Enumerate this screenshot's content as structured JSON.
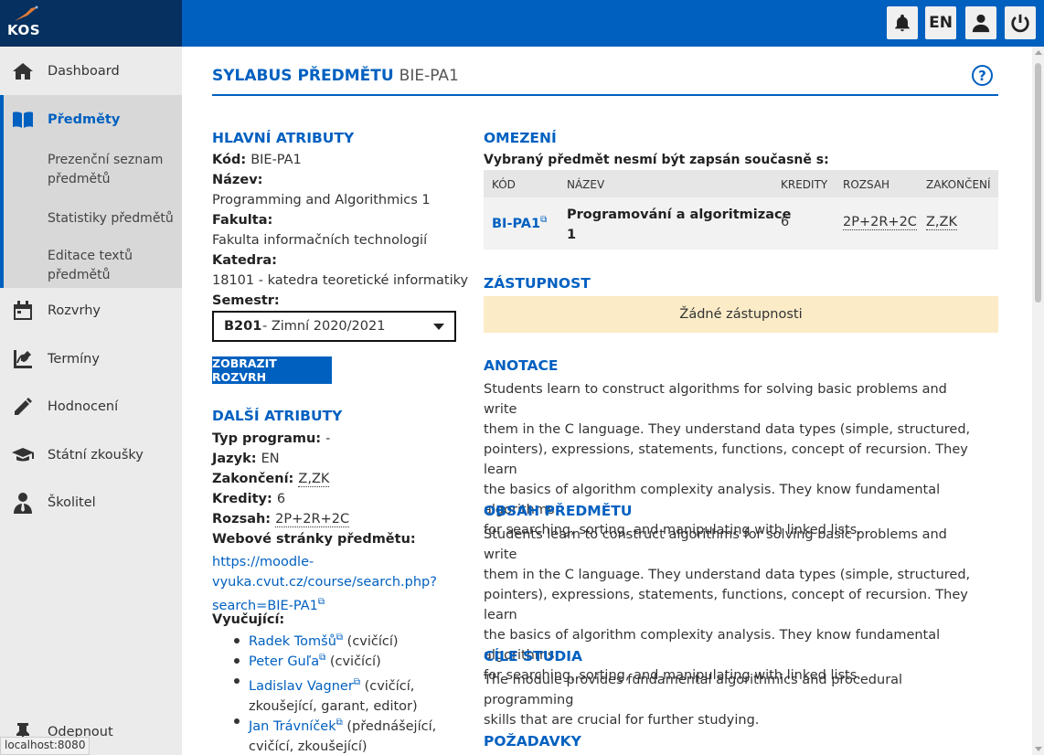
{
  "app": {
    "logo": "KOS",
    "status_url": "localhost:8080"
  },
  "topbar": {
    "lang": "EN"
  },
  "sidebar": {
    "items": [
      {
        "label": "Dashboard",
        "icon": "home-icon"
      },
      {
        "label": "Předměty",
        "icon": "book-icon"
      },
      {
        "label": "Rozvrhy",
        "icon": "calendar-icon"
      },
      {
        "label": "Termíny",
        "icon": "signature-icon"
      },
      {
        "label": "Hodnocení",
        "icon": "pencil-icon"
      },
      {
        "label": "Státní zkoušky",
        "icon": "graduation-cap-icon"
      },
      {
        "label": "Školitel",
        "icon": "person-tie-icon"
      }
    ],
    "subitems": [
      "Prezenční seznam předmětů",
      "Statistiky předmětů",
      "Editace textů předmětů"
    ],
    "unpin": "Odepnout"
  },
  "page": {
    "title": "SYLABUS PŘEDMĚTU",
    "code": "BIE-PA1"
  },
  "main_attrs": {
    "heading": "HLAVNÍ ATRIBUTY",
    "kod_label": "Kód:",
    "kod": "BIE-PA1",
    "nazev_label": "Název:",
    "nazev": "Programming and Algorithmics 1",
    "fakulta_label": "Fakulta:",
    "fakulta": "Fakulta informačních technologií",
    "katedra_label": "Katedra:",
    "katedra": "18101 - katedra teoretické informatiky",
    "semestr_label": "Semestr:",
    "semestr_code": "B201",
    "semestr_rest": " - Zimní 2020/2021",
    "show_schedule": "ZOBRAZIT ROZVRH"
  },
  "other_attrs": {
    "heading": "DALŠÍ ATRIBUTY",
    "typ_label": "Typ programu:",
    "typ": "-",
    "jazyk_label": "Jazyk:",
    "jazyk": "EN",
    "zakonceni_label": "Zakončení:",
    "zakonceni": "Z,ZK",
    "kredity_label": "Kredity:",
    "kredity": "6",
    "rozsah_label": "Rozsah:",
    "rozsah": "2P+2R+2C",
    "web_label": "Webové stránky předmětu:",
    "web_line1": "https://moodle-",
    "web_line2": "vyuka.cvut.cz/course/search.php?",
    "web_line3": "search=BIE-PA1",
    "teachers_label": "Vyučující:",
    "teachers": [
      {
        "name": "Radek Tomšů",
        "role": "(cvičící)"
      },
      {
        "name": "Peter Guľa",
        "role": "(cvičící)"
      },
      {
        "name": "Ladislav Vagner",
        "role": "(cvičící,",
        "role2": "zkoušející, garant, editor)"
      },
      {
        "name": "Jan Trávníček",
        "role": "(přednášející,",
        "role2": "cvičící, zkoušející)"
      }
    ]
  },
  "restrictions": {
    "heading": "OMEZENÍ",
    "subheading": "Vybraný předmět nesmí být zapsán současně s:",
    "columns": [
      "KÓD",
      "NÁZEV",
      "KREDITY",
      "ROZSAH",
      "ZAKONČENÍ"
    ],
    "rows": [
      {
        "kod": "BI-PA1",
        "nazev1": "Programování a algoritmizace",
        "nazev2": "1",
        "kredity": "6",
        "rozsah": "2P+2R+2C",
        "zakonceni": "Z,ZK"
      }
    ]
  },
  "substitutes": {
    "heading": "ZÁSTUPNOST",
    "empty": "Žádné zástupnosti"
  },
  "annotation": {
    "heading": "ANOTACE",
    "lines": [
      "Students learn to construct algorithms for solving basic problems and write",
      "them in the C language. They understand data types (simple, structured,",
      "pointers), expressions, statements, functions, concept of recursion. They learn",
      "the basics of algorithm complexity analysis. They know fundamental algorithms",
      "for searching, sorting, and manipulating with linked lists."
    ]
  },
  "content": {
    "heading": "OBSAH PŘEDMĚTU",
    "lines": [
      "Students learn to construct algorithms for solving basic problems and write",
      "them in the C language. They understand data types (simple, structured,",
      "pointers), expressions, statements, functions, concept of recursion. They learn",
      "the basics of algorithm complexity analysis. They know fundamental algorithms",
      "for searching, sorting, and manipulating with linked lists."
    ]
  },
  "goals": {
    "heading": "CÍLE STUDIA",
    "lines": [
      "The module provides fundamental algorithmics and procedural programming",
      "skills that are crucial for further studying."
    ]
  },
  "requirements": {
    "heading": "POŽADAVKY"
  },
  "colors": {
    "primary": "#0060c0",
    "logo_bg": "#05305f",
    "warning_bg": "#fbebc7"
  }
}
